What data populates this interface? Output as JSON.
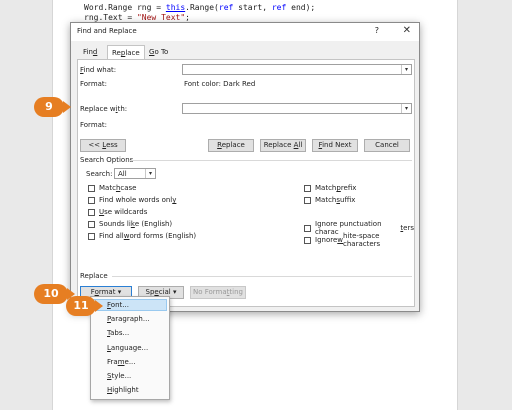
{
  "code": {
    "line1_a": "Word.Range rng = ",
    "line1_this": "this",
    "line1_b": ".Range(",
    "line1_ref1": "ref",
    "line1_c": " start, ",
    "line1_ref2": "ref",
    "line1_d": " end);",
    "line2_a": "rng.Text = ",
    "line2_str": "\"New Text\"",
    "line2_b": ";"
  },
  "dialog": {
    "title": "Find and Replace",
    "help": "?",
    "close": "✕",
    "tabs": {
      "find_pre": "Fin",
      "find_u": "d",
      "find_post": "",
      "replace_pre": "Re",
      "replace_u": "p",
      "replace_post": "lace",
      "goto_pre": "",
      "goto_u": "G",
      "goto_post": "o To"
    },
    "find_what_pre": "",
    "find_what_u": "F",
    "find_what_post": "ind what:",
    "find_format_label": "Format:",
    "find_format_value": "Font color: Dark Red",
    "replace_with_pre": "Replace w",
    "replace_with_u": "i",
    "replace_with_post": "th:",
    "replace_format_label": "Format:",
    "buttons": {
      "less_pre": "<< ",
      "less_u": "L",
      "less_post": "ess",
      "replace_pre": "",
      "replace_u": "R",
      "replace_post": "eplace",
      "replace_all_pre": "Replace ",
      "replace_all_u": "A",
      "replace_all_post": "ll",
      "find_next_pre": "",
      "find_next_u": "F",
      "find_next_post": "ind Next",
      "cancel": "Cancel"
    },
    "search_options_title": "Search Options",
    "search_label_pre": "Search",
    "search_label_u": "",
    "search_label_post": ":",
    "search_value": "All",
    "options_left": [
      {
        "pre": "Matc",
        "u": "h",
        "post": " case"
      },
      {
        "pre": "Find whole words onl",
        "u": "y",
        "post": ""
      },
      {
        "pre": "",
        "u": "U",
        "post": "se wildcards"
      },
      {
        "pre": "Sounds li",
        "u": "k",
        "post": "e (English)"
      },
      {
        "pre": "Find all ",
        "u": "w",
        "post": "ord forms (English)"
      }
    ],
    "options_right": [
      {
        "pre": "Match ",
        "u": "p",
        "post": "refix"
      },
      {
        "pre": "Match ",
        "u": "s",
        "post": "uffix"
      },
      {
        "pre": "Ignore punctuation charac",
        "u": "t",
        "post": "ers"
      },
      {
        "pre": "Ignore ",
        "u": "w",
        "post": "hite-space characters"
      }
    ],
    "replace_section_title": "Replace",
    "format_btn_pre": "F",
    "format_btn_u": "o",
    "format_btn_post": "rmat ▾",
    "special_btn_pre": "Sp",
    "special_btn_u": "e",
    "special_btn_post": "cial ▾",
    "no_formatting_pre": "No Forma",
    "no_formatting_u": "t",
    "no_formatting_post": "ting"
  },
  "format_menu": [
    {
      "pre": "",
      "u": "F",
      "post": "ont..."
    },
    {
      "pre": "",
      "u": "P",
      "post": "aragraph..."
    },
    {
      "pre": "",
      "u": "T",
      "post": "abs..."
    },
    {
      "pre": "",
      "u": "L",
      "post": "anguage..."
    },
    {
      "pre": "Fra",
      "u": "m",
      "post": "e..."
    },
    {
      "pre": "",
      "u": "S",
      "post": "tyle..."
    },
    {
      "pre": "",
      "u": "H",
      "post": "ighlight"
    }
  ],
  "callouts": {
    "c9": "9",
    "c10": "10",
    "c11": "11"
  },
  "colors": {
    "callout": "#e67e22",
    "menu_highlight": "#cce4f7"
  }
}
